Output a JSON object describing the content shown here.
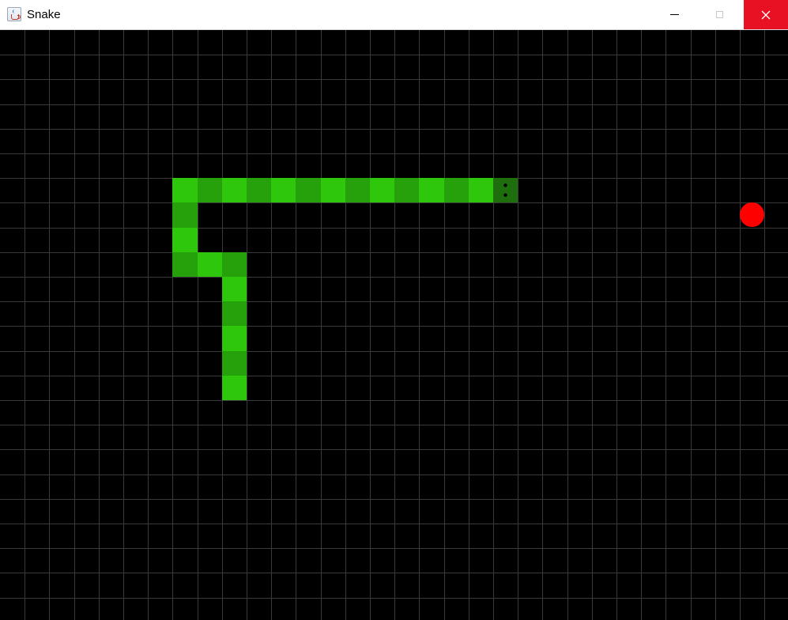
{
  "window": {
    "title": "Snake",
    "icon": "java-coffee-cup-icon",
    "controls": [
      "minimize-icon",
      "maximize-icon",
      "close-icon"
    ],
    "close_color": "#e81123"
  },
  "game": {
    "grid_columns": 32,
    "grid_rows": 24,
    "background_color": "#000000",
    "grid_line_color": "#3a3a3a",
    "snake_colors": {
      "light": "#2ec70b",
      "dark": "#27a10b",
      "head": "#1f6e0d"
    },
    "snake_direction": "right",
    "food_color": "#ff0000",
    "snake": [
      [
        20,
        6
      ],
      [
        19,
        6
      ],
      [
        18,
        6
      ],
      [
        17,
        6
      ],
      [
        16,
        6
      ],
      [
        15,
        6
      ],
      [
        14,
        6
      ],
      [
        13,
        6
      ],
      [
        12,
        6
      ],
      [
        11,
        6
      ],
      [
        10,
        6
      ],
      [
        9,
        6
      ],
      [
        8,
        6
      ],
      [
        7,
        6
      ],
      [
        7,
        7
      ],
      [
        7,
        8
      ],
      [
        7,
        9
      ],
      [
        8,
        9
      ],
      [
        9,
        9
      ],
      [
        9,
        10
      ],
      [
        9,
        11
      ],
      [
        9,
        12
      ],
      [
        9,
        13
      ],
      [
        9,
        14
      ]
    ],
    "food": [
      30,
      7
    ]
  }
}
